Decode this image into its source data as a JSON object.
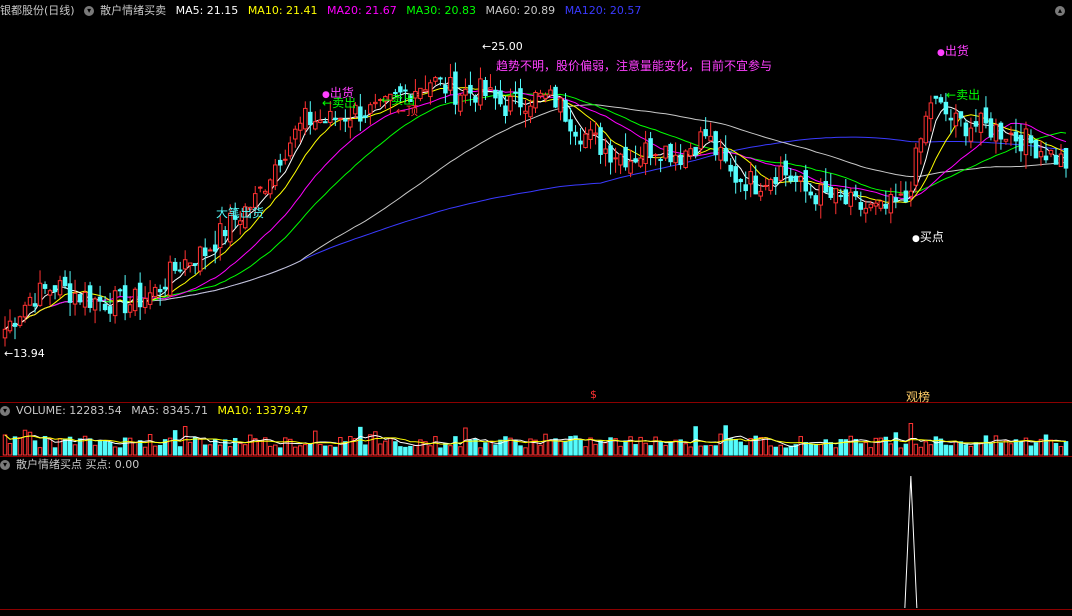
{
  "header": {
    "stock": "银都股份(日线)",
    "indicator": "散户情绪买卖",
    "ma": [
      {
        "label": "MA5: 21.15",
        "color": "#ffffff"
      },
      {
        "label": "MA10: 21.41",
        "color": "#ffff00"
      },
      {
        "label": "MA20: 21.67",
        "color": "#ff00ff"
      },
      {
        "label": "MA30: 20.83",
        "color": "#00ff00"
      },
      {
        "label": "MA60: 20.89",
        "color": "#c8c8c8"
      },
      {
        "label": "MA120: 20.57",
        "color": "#3a3aff"
      }
    ]
  },
  "volume_header": {
    "vol": "VOLUME: 12283.54",
    "ma5": "MA5: 8345.71",
    "ma10": "MA10: 13379.47"
  },
  "signal_header": {
    "label": "散户情绪买点 买点: 0.00"
  },
  "annotations": {
    "high": "25.00",
    "low": "13.94",
    "warning": "趋势不明，股价偏弱，注意量能变化，目前不宜参与",
    "sell1": "出货",
    "sell2": "卖出",
    "sell3": "卖出",
    "top": "顶",
    "big_sell": "大笔出货",
    "sell4": "出货",
    "sell5": "卖出",
    "buy": "买点",
    "dollar": "$",
    "rank": "观榜"
  },
  "colors": {
    "up": "#ff3232",
    "down": "#54fcfc",
    "ma5": "#ffffff",
    "ma10": "#ffff00",
    "ma20": "#ff00ff",
    "ma30": "#00ff00",
    "ma60": "#c8c8c8",
    "ma120": "#3a3aff"
  },
  "chart_data": {
    "type": "candlestick",
    "price_range": [
      13.0,
      26.0
    ],
    "high": 25.0,
    "low": 13.94,
    "anchors": [
      [
        0,
        15.2
      ],
      [
        5,
        16.3
      ],
      [
        10,
        16.7
      ],
      [
        18,
        16.2
      ],
      [
        25,
        16.1
      ],
      [
        30,
        16.5
      ],
      [
        35,
        17.5
      ],
      [
        40,
        17.9
      ],
      [
        45,
        18.9
      ],
      [
        50,
        19.7
      ],
      [
        55,
        21.3
      ],
      [
        60,
        22.5
      ],
      [
        65,
        22.5
      ],
      [
        70,
        22.8
      ],
      [
        75,
        22.8
      ],
      [
        80,
        23.5
      ],
      [
        85,
        23.9
      ],
      [
        90,
        23.5
      ],
      [
        95,
        23.5
      ],
      [
        100,
        23.0
      ],
      [
        105,
        23.3
      ],
      [
        110,
        23.2
      ],
      [
        115,
        22.1
      ],
      [
        120,
        21.5
      ],
      [
        125,
        21.2
      ],
      [
        130,
        21.6
      ],
      [
        135,
        21.3
      ],
      [
        140,
        22.0
      ],
      [
        145,
        20.6
      ],
      [
        150,
        20.3
      ],
      [
        155,
        20.8
      ],
      [
        160,
        20.0
      ],
      [
        165,
        19.8
      ],
      [
        170,
        19.5
      ],
      [
        175,
        19.3
      ],
      [
        180,
        19.7
      ],
      [
        185,
        23.2
      ],
      [
        190,
        22.4
      ],
      [
        195,
        22.3
      ],
      [
        200,
        22.1
      ],
      [
        205,
        21.7
      ],
      [
        212,
        21.0
      ]
    ],
    "volume_max": 40000,
    "signal_spike_index": 181
  }
}
